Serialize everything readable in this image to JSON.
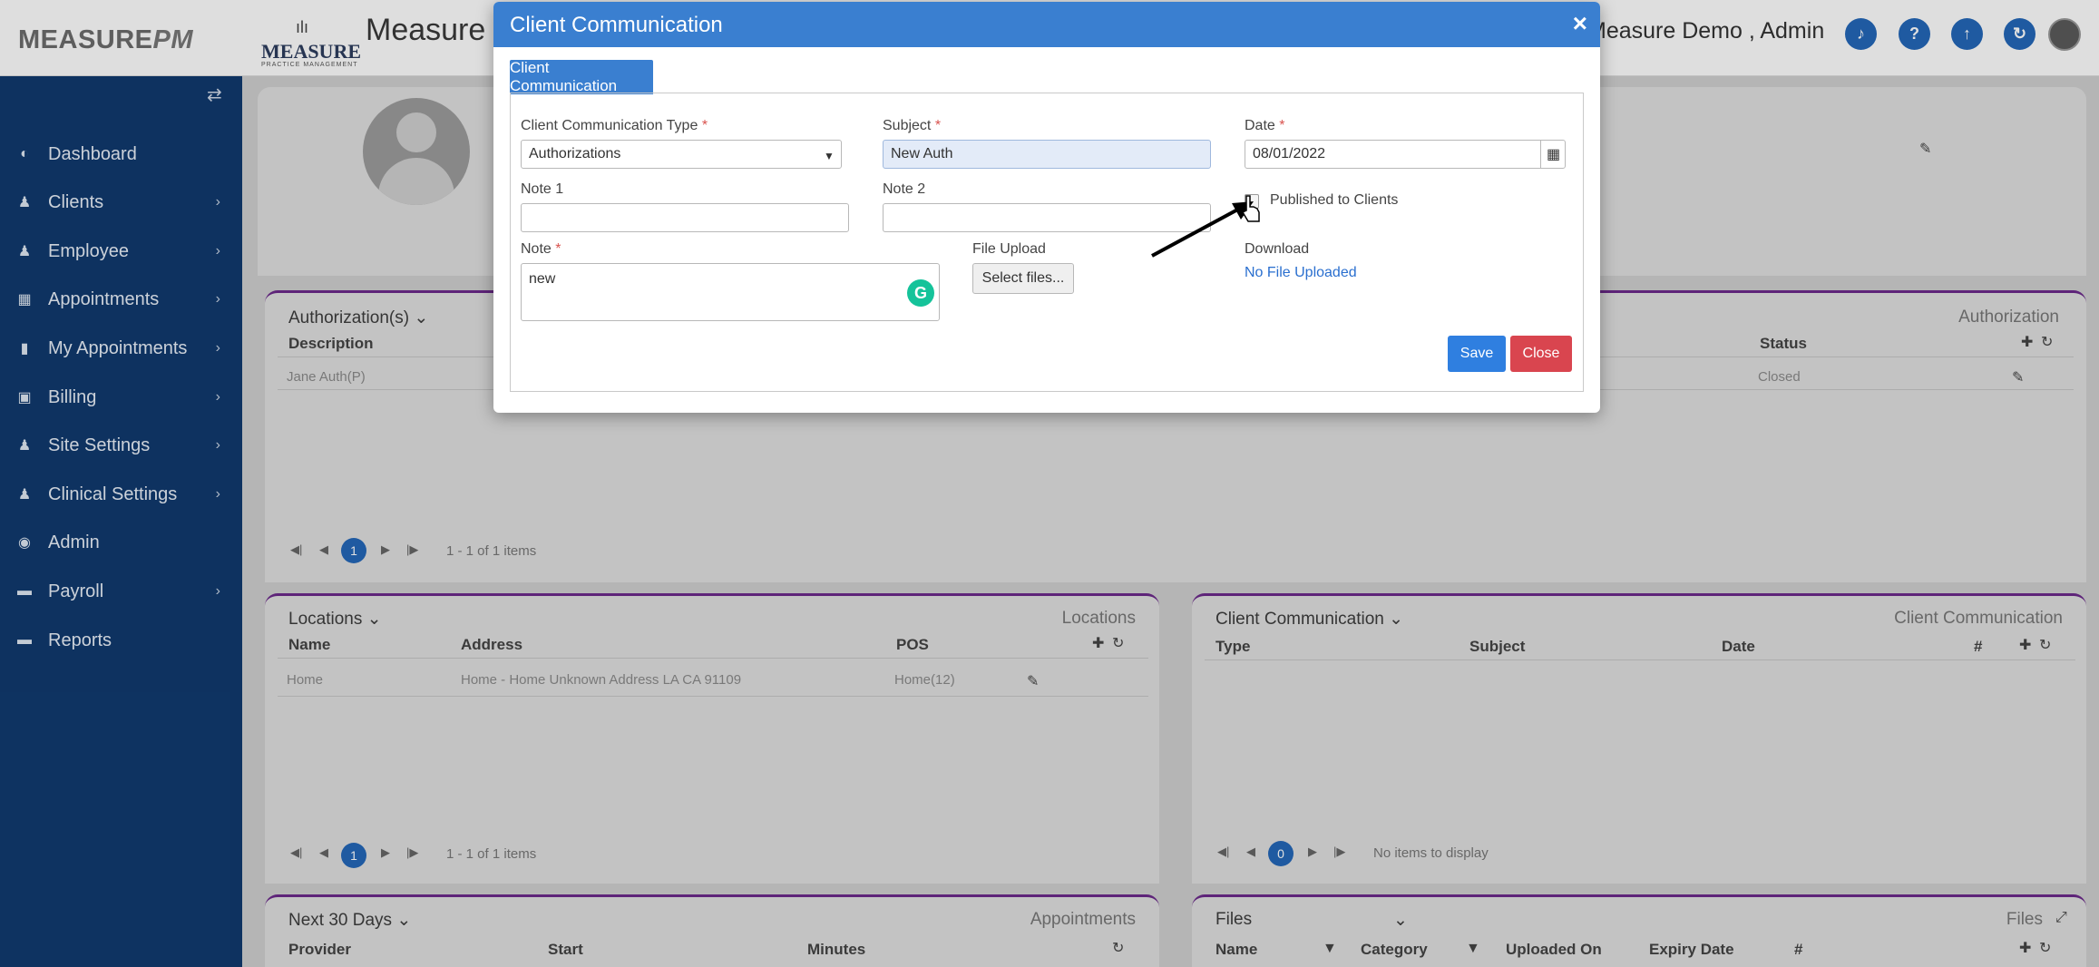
{
  "header": {
    "logo_main": "MEASURE",
    "logo_pm": "PM",
    "practice_logo_word": "MEASURE",
    "practice_logo_tag": "PRACTICE MANAGEMENT",
    "app_title": "Measure",
    "user_name": "Measure Demo , Admin",
    "icons": [
      "bell-icon",
      "help-icon",
      "upload-icon",
      "refresh-icon"
    ]
  },
  "sidebar": {
    "items": [
      {
        "label": "Dashboard",
        "icon": "dashboard-icon",
        "has_children": false
      },
      {
        "label": "Clients",
        "icon": "user-icon",
        "has_children": true
      },
      {
        "label": "Employee",
        "icon": "users-icon",
        "has_children": true
      },
      {
        "label": "Appointments",
        "icon": "calendar-icon",
        "has_children": true
      },
      {
        "label": "My Appointments",
        "icon": "book-icon",
        "has_children": true
      },
      {
        "label": "Billing",
        "icon": "money-icon",
        "has_children": true
      },
      {
        "label": "Site Settings",
        "icon": "user-icon",
        "has_children": true
      },
      {
        "label": "Clinical Settings",
        "icon": "user-icon",
        "has_children": true
      },
      {
        "label": "Admin",
        "icon": "user-circle-icon",
        "has_children": false
      },
      {
        "label": "Payroll",
        "icon": "card-icon",
        "has_children": true
      },
      {
        "label": "Reports",
        "icon": "card-icon",
        "has_children": false
      }
    ]
  },
  "authorizations": {
    "dropdown_label": "Authorization(s)",
    "right_title": "Authorization",
    "col_description": "Description",
    "col_status": "Status",
    "rows": [
      {
        "description": "Jane Auth(P)",
        "status": "Closed"
      }
    ],
    "page": "1",
    "pager_text": "1 - 1 of 1 items"
  },
  "locations": {
    "dropdown_label": "Locations",
    "right_title": "Locations",
    "columns": [
      "Name",
      "Address",
      "POS"
    ],
    "rows": [
      {
        "name": "Home",
        "address": "Home - Home Unknown Address LA CA 91109",
        "pos": "Home(12)"
      }
    ],
    "page": "1",
    "pager_text": "1 - 1 of 1 items"
  },
  "client_comm": {
    "dropdown_label": "Client Communication",
    "right_title": "Client Communication",
    "columns": [
      "Type",
      "Subject",
      "Date",
      "#"
    ],
    "page": "0",
    "pager_text": "No items to display"
  },
  "appointments": {
    "dropdown_label": "Next 30 Days",
    "right_title": "Appointments",
    "columns": [
      "Provider",
      "Start",
      "Minutes"
    ]
  },
  "files": {
    "dropdown_label": "Files",
    "right_title": "Files",
    "columns": [
      "Name",
      "Category",
      "Uploaded On",
      "Expiry Date",
      "#"
    ]
  },
  "modal": {
    "title": "Client Communication",
    "tab_label": "Client Communication",
    "type_label": "Client Communication Type",
    "type_value": "Authorizations",
    "subject_label": "Subject",
    "subject_value": "New Auth",
    "date_label": "Date",
    "date_value": "08/01/2022",
    "note1_label": "Note 1",
    "note1_value": "",
    "note2_label": "Note 2",
    "note2_value": "",
    "published_label": "Published to Clients",
    "published_checked": false,
    "note_label": "Note",
    "note_value": "new",
    "file_upload_label": "File Upload",
    "select_files_label": "Select files...",
    "download_label": "Download",
    "download_value": "No File Uploaded",
    "save_label": "Save",
    "close_label": "Close",
    "required_marker": "*"
  },
  "colors": {
    "sidebar": "#103a6e",
    "modal_header": "#3a7fd0",
    "save": "#2f7fe0",
    "close": "#d9454f",
    "panel_accent": "#6b2a8a"
  }
}
